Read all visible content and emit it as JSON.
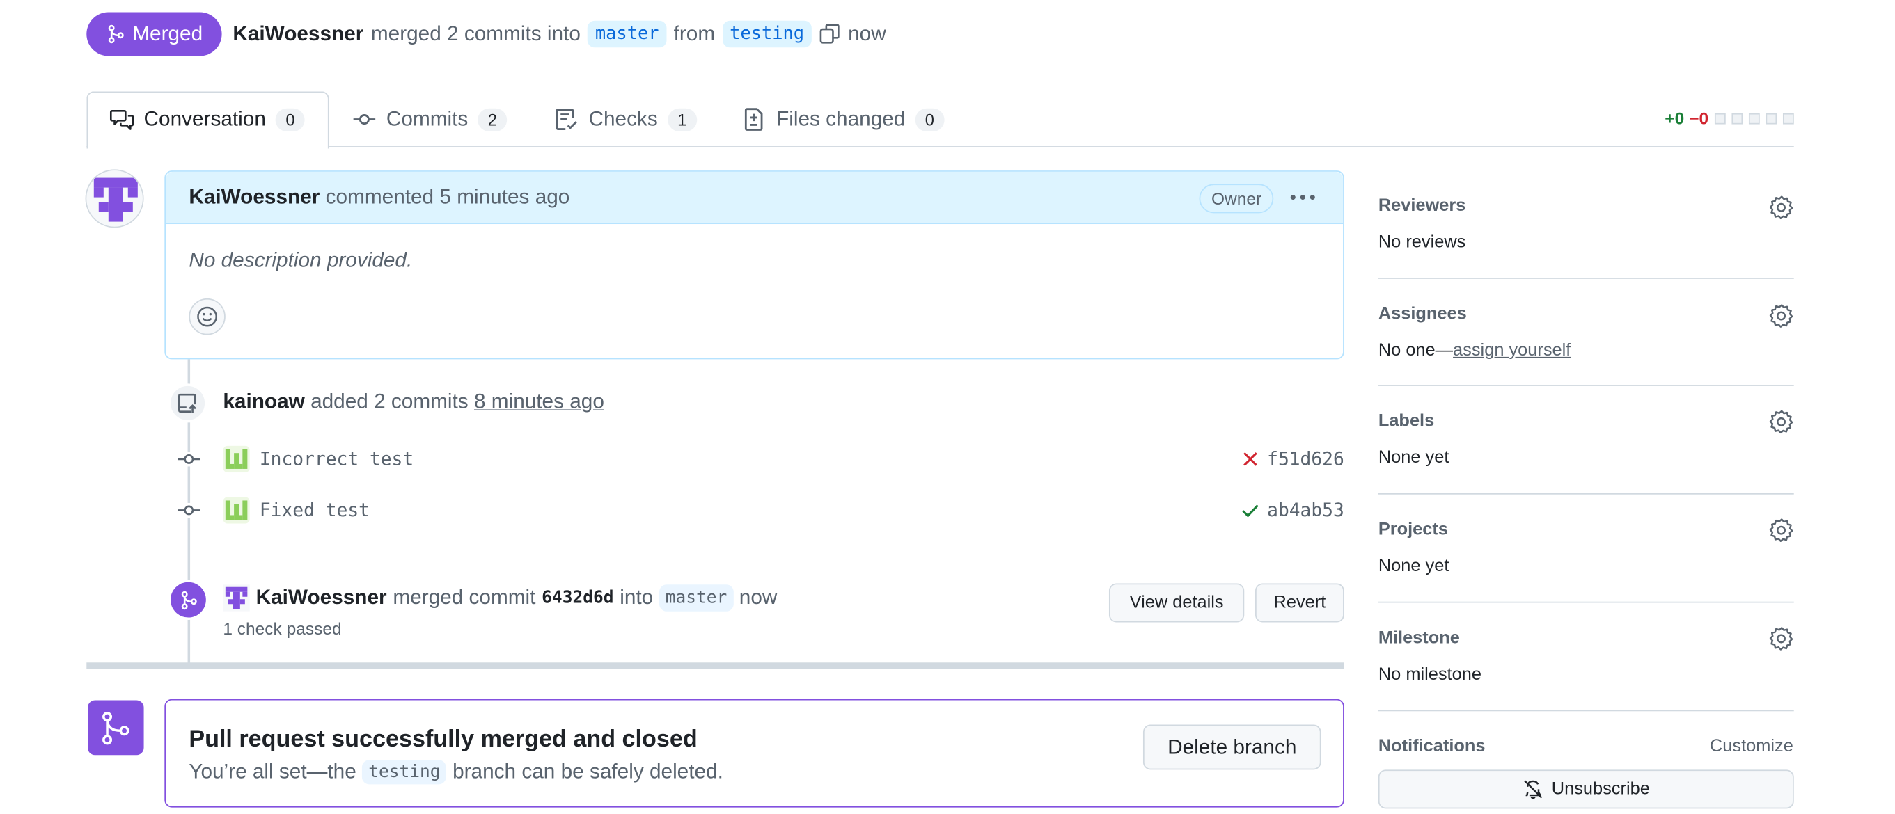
{
  "header": {
    "status": "Merged",
    "author": "KaiWoessner",
    "merged_text": "merged 2 commits into",
    "base_branch": "master",
    "from_text": "from",
    "head_branch": "testing",
    "time": "now",
    "status_color": "#8250df"
  },
  "tabs": [
    {
      "label": "Conversation",
      "count": "0",
      "icon": "comment-discussion-icon"
    },
    {
      "label": "Commits",
      "count": "2",
      "icon": "git-commit-icon"
    },
    {
      "label": "Checks",
      "count": "1",
      "icon": "checklist-icon"
    },
    {
      "label": "Files changed",
      "count": "0",
      "icon": "file-diff-icon"
    }
  ],
  "diffstat": {
    "added": "+0",
    "removed": "−0"
  },
  "comment": {
    "author": "KaiWoessner",
    "action": "commented",
    "time": "5 minutes ago",
    "badge": "Owner",
    "body": "No description provided."
  },
  "push_event": {
    "actor": "kainoaw",
    "action": "added 2 commits",
    "time": "8 minutes ago"
  },
  "commits": [
    {
      "message": "Incorrect test",
      "sha": "f51d626",
      "status": "failure"
    },
    {
      "message": "Fixed test",
      "sha": "ab4ab53",
      "status": "success"
    }
  ],
  "merge_event": {
    "actor": "KaiWoessner",
    "action": "merged commit",
    "sha": "6432d6d",
    "into": "into",
    "branch": "master",
    "time": "now",
    "checks": "1 check passed",
    "view_details": "View details",
    "revert": "Revert"
  },
  "merge_box": {
    "title": "Pull request successfully merged and closed",
    "sub_before": "You’re all set—the",
    "branch": "testing",
    "sub_after": "branch can be safely deleted.",
    "delete_button": "Delete branch"
  },
  "sidebar": {
    "reviewers": {
      "title": "Reviewers",
      "value": "No reviews"
    },
    "assignees": {
      "title": "Assignees",
      "value": "No one—",
      "link": "assign yourself"
    },
    "labels": {
      "title": "Labels",
      "value": "None yet"
    },
    "projects": {
      "title": "Projects",
      "value": "None yet"
    },
    "milestone": {
      "title": "Milestone",
      "value": "No milestone"
    },
    "notifications": {
      "title": "Notifications",
      "customize": "Customize",
      "button": "Unsubscribe"
    }
  }
}
